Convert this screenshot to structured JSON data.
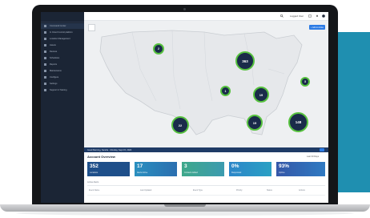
{
  "sidebar": {
    "items": [
      {
        "label": "Command Center",
        "active": true
      },
      {
        "label": "In Cloud Control platform"
      },
      {
        "label": "Location Management"
      },
      {
        "label": "Assets"
      },
      {
        "label": "Devices"
      },
      {
        "label": "Schedules"
      },
      {
        "label": "Reports"
      },
      {
        "label": "Maintenance"
      },
      {
        "label": "Configure"
      },
      {
        "label": "Settings"
      },
      {
        "label": "Support & Training"
      }
    ]
  },
  "topbar": {
    "username": "Logged User"
  },
  "map": {
    "action_label": "+ Add to Active",
    "clusters": [
      {
        "value": "2"
      },
      {
        "value": "363"
      },
      {
        "value": "1"
      },
      {
        "value": "19"
      },
      {
        "value": "3"
      },
      {
        "value": "22"
      },
      {
        "value": "19"
      },
      {
        "value": "148"
      }
    ]
  },
  "strip": {
    "text": "Good Morning, Sandra  ·  Monday, Sept 15, 2020",
    "toggle_label": "Map"
  },
  "overview": {
    "title": "Account Overview",
    "filter": "Last 30 Days",
    "cards": [
      {
        "value": "352",
        "label": "Locations",
        "color": "#1e4f8a"
      },
      {
        "value": "17",
        "label": "Alerts Active",
        "color": "#2a8fbf"
      },
      {
        "value": "3",
        "label": "Contacts Added",
        "color": "#3fa88a"
      },
      {
        "value": "0%",
        "label": "Responded",
        "color": "#2c86c9"
      },
      {
        "value": "93%",
        "label": "Uptime",
        "color": "#3557a8"
      }
    ],
    "sub_label": "Active Alerts",
    "columns": [
      "Event Name",
      "Last Updated",
      "Event Type",
      "Priority",
      "Status",
      "Actions"
    ]
  },
  "colors": {
    "cluster_ring": "#57c23f",
    "cluster_fill": "#1a2b4a",
    "sidebar": "#1b2535",
    "accent": "#2c7be5"
  }
}
